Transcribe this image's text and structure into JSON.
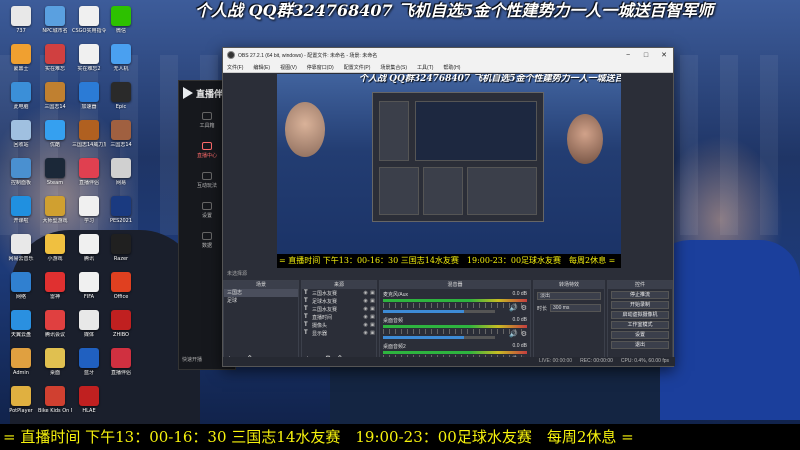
{
  "banner_top": "个人战 QQ群324768407 飞机自选5金个性建势力一人一城送百智军师",
  "banner_bottom": "= 直播时间 下午13：00-16：30 三国志14水友赛　19:00-23：00足球水友赛　每周2休息 =",
  "desktop_icons": [
    {
      "label": "737",
      "color": "#e8e8e8"
    },
    {
      "label": "NPC城市名",
      "color": "#5aa0e0"
    },
    {
      "label": "CSGO实用指令",
      "color": "#f0f0f0"
    },
    {
      "label": "微信",
      "color": "#2dc100"
    },
    {
      "label": "蒙鼎士",
      "color": "#f0a030"
    },
    {
      "label": "实在难忘",
      "color": "#d04040"
    },
    {
      "label": "实在难忘2",
      "color": "#f0f0f0"
    },
    {
      "label": "无人机",
      "color": "#4aa0f0"
    },
    {
      "label": "此电脑",
      "color": "#3b8fd8"
    },
    {
      "label": "三国志14",
      "color": "#c08030"
    },
    {
      "label": "加速器",
      "color": "#2b7bd6"
    },
    {
      "label": "Epic",
      "color": "#2a2a2a"
    },
    {
      "label": "回收站",
      "color": "#a0c0e0"
    },
    {
      "label": "优酷",
      "color": "#35a0f0"
    },
    {
      "label": "三国志14威力加强版",
      "color": "#b06020"
    },
    {
      "label": "三国志14",
      "color": "#a06040"
    },
    {
      "label": "控制面板",
      "color": "#4a90d0"
    },
    {
      "label": "Steam",
      "color": "#1b2838"
    },
    {
      "label": "直播伴侣",
      "color": "#e04050"
    },
    {
      "label": "网易",
      "color": "#d0d0d0"
    },
    {
      "label": "开课啦",
      "color": "#2090e0"
    },
    {
      "label": "大师型游戏",
      "color": "#d0a030"
    },
    {
      "label": "学习",
      "color": "#f0f0f0"
    },
    {
      "label": "PES2021",
      "color": "#1a3a80"
    },
    {
      "label": "网易云音乐",
      "color": "#e8e8e8"
    },
    {
      "label": "小游戏",
      "color": "#f0c040"
    },
    {
      "label": "腾讯",
      "color": "#f0f0f0"
    },
    {
      "label": "Razer",
      "color": "#202020"
    },
    {
      "label": "网络",
      "color": "#3080d0"
    },
    {
      "label": "雷神",
      "color": "#e03030"
    },
    {
      "label": "FIFA",
      "color": "#f0f0f0"
    },
    {
      "label": "Office",
      "color": "#e04020"
    },
    {
      "label": "天翼云盘",
      "color": "#2a90e0"
    },
    {
      "label": "腾讯会议",
      "color": "#e04040"
    },
    {
      "label": "媒体",
      "color": "#e8e8e8"
    },
    {
      "label": "ZHIBO",
      "color": "#c02020"
    },
    {
      "label": "Admin",
      "color": "#e0a040"
    },
    {
      "label": "桌面",
      "color": "#e0c050"
    },
    {
      "label": "蓝牙",
      "color": "#2060c0"
    },
    {
      "label": "直播伴侣",
      "color": "#d03040"
    },
    {
      "label": "PotPlayer",
      "color": "#e0b040"
    },
    {
      "label": "Bike Kids On My Quest",
      "color": "#d04030"
    },
    {
      "label": "HLAE",
      "color": "#c02020"
    }
  ],
  "live_app": {
    "title": "直播伴",
    "items": [
      {
        "label": "工具箱",
        "active": false
      },
      {
        "label": "直播中心",
        "active": true
      },
      {
        "label": "互动玩法",
        "active": false
      },
      {
        "label": "设置",
        "active": false
      },
      {
        "label": "数据",
        "active": false
      }
    ],
    "bottom": "快速开播"
  },
  "obs": {
    "title": "OBS 27.2.1 (64 bit, windows) - 配置文件: 未命名 - 场景: 未命名",
    "window_buttons": [
      "−",
      "□",
      "✕"
    ],
    "menu": [
      "文件(F)",
      "编辑(E)",
      "视图(V)",
      "停靠窗口(D)",
      "配置文件(P)",
      "场景集合(S)",
      "工具(T)",
      "帮助(H)"
    ],
    "preview_banner_top": "个人战 QQ群324768407 飞机自选5金个性建势力一人一城送百智军师",
    "preview_banner_bottom": "= 直播时间 下午13：00-16：30 三国志14水友赛　19:00-23：00足球水友赛　每周2休息 =",
    "scene_label": "未选择源",
    "scenes": {
      "header": "场景",
      "items": [
        {
          "label": "三国志",
          "selected": true
        },
        {
          "label": "足球",
          "selected": false
        }
      ]
    },
    "sources": {
      "header": "来源",
      "items": [
        {
          "label": "三国水友赛"
        },
        {
          "label": "足球水友赛"
        },
        {
          "label": "三国水友赛"
        },
        {
          "label": "直播时间"
        },
        {
          "label": "摄像头"
        },
        {
          "label": "显示器"
        }
      ]
    },
    "mixer": {
      "header": "混音器",
      "tracks": [
        {
          "name": "麦克风/Aux",
          "db": "0.0 dB",
          "level": 0.72
        },
        {
          "name": "桌面音频",
          "db": "0.0 dB",
          "level": 0.72
        },
        {
          "name": "桌面音频2",
          "db": "0.0 dB",
          "level": 0.72
        }
      ]
    },
    "transitions": {
      "header": "转场特效",
      "type": "淡出",
      "duration_label": "时长",
      "duration": "300 ms"
    },
    "controls": {
      "header": "控件",
      "buttons": [
        "停止推流",
        "开始录制",
        "启动虚拟摄像机",
        "工作室模式",
        "设置",
        "退出"
      ]
    },
    "status": {
      "live": "LIVE: 00:00:00",
      "rec": "REC: 00:00:00",
      "cpu": "CPU: 0.4%, 60.00 fps"
    }
  }
}
